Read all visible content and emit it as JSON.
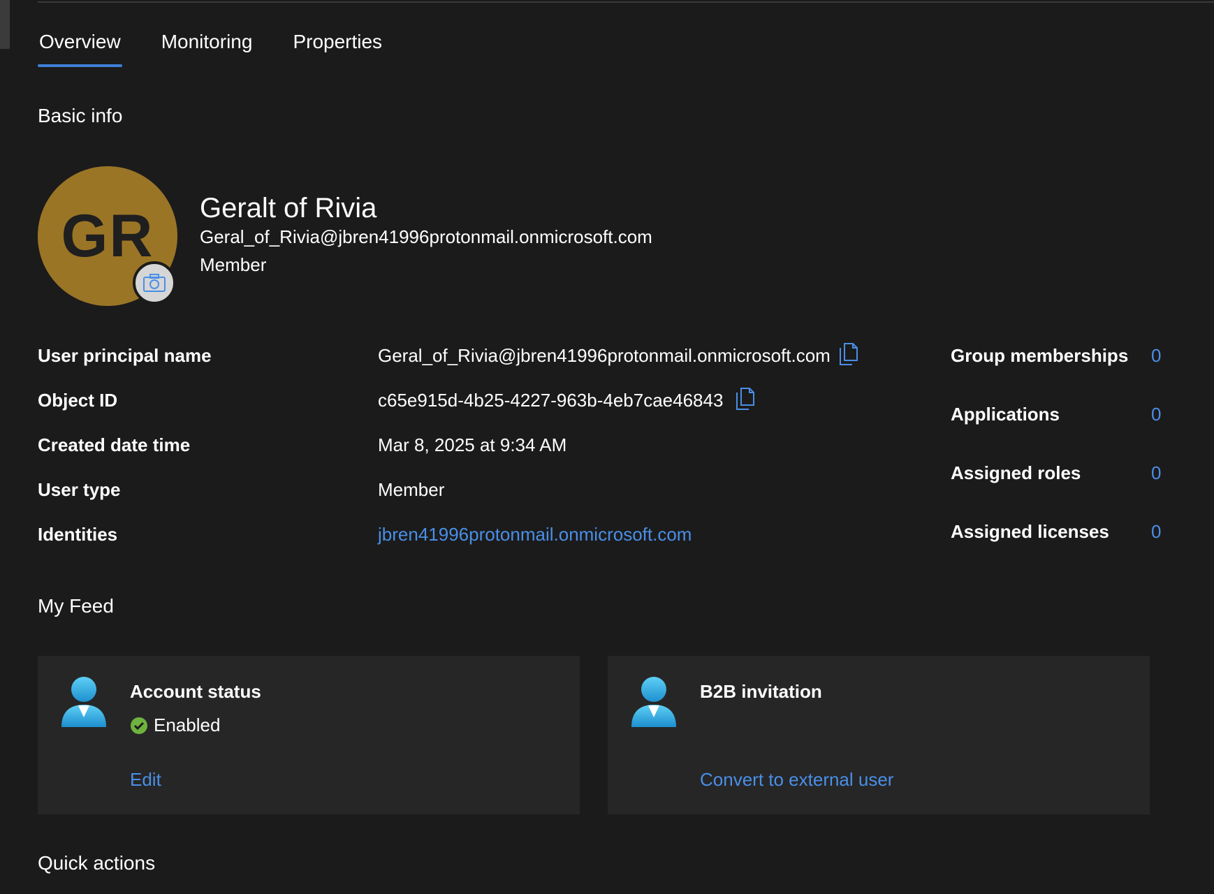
{
  "tabs": [
    {
      "label": "Overview",
      "active": true
    },
    {
      "label": "Monitoring",
      "active": false
    },
    {
      "label": "Properties",
      "active": false
    }
  ],
  "basic_info": {
    "title": "Basic info",
    "avatar_initials": "GR",
    "avatar_color": "#9b7526",
    "display_name": "Geralt of Rivia",
    "email": "Geral_of_Rivia@jbren41996protonmail.onmicrosoft.com",
    "role": "Member",
    "camera_icon": "camera-icon"
  },
  "properties": [
    {
      "label": "User principal name",
      "value": "Geral_of_Rivia@jbren41996protonmail.onmicrosoft.com",
      "copy": true
    },
    {
      "label": "Object ID",
      "value": "c65e915d-4b25-4227-963b-4eb7cae46843",
      "copy": true
    },
    {
      "label": "Created date time",
      "value": "Mar 8, 2025 at 9:34 AM",
      "copy": false
    },
    {
      "label": "User type",
      "value": "Member",
      "copy": false
    },
    {
      "label": "Identities",
      "value": "jbren41996protonmail.onmicrosoft.com",
      "copy": false,
      "link": true
    }
  ],
  "stats": [
    {
      "label": "Group memberships",
      "value": "0"
    },
    {
      "label": "Applications",
      "value": "0"
    },
    {
      "label": "Assigned roles",
      "value": "0"
    },
    {
      "label": "Assigned licenses",
      "value": "0"
    }
  ],
  "feed": {
    "title": "My Feed",
    "cards": [
      {
        "title": "Account status",
        "status": "Enabled",
        "status_color": "#6fb33f",
        "link": "Edit",
        "icon": "person-icon"
      },
      {
        "title": "B2B invitation",
        "status": "",
        "link": "Convert to external user",
        "icon": "person-icon"
      }
    ]
  },
  "quick_actions": {
    "title": "Quick actions"
  },
  "colors": {
    "background": "#1b1b1b",
    "card": "#262626",
    "accent": "#3f7fd6",
    "link": "#4a8fe7"
  }
}
